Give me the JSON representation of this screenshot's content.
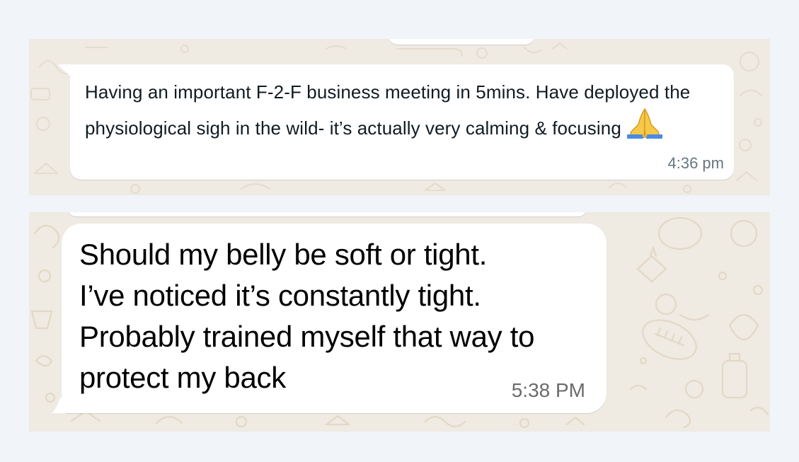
{
  "screenshot_1": {
    "message": {
      "text": "Having an important F-2-F business meeting in 5mins. Have deployed the physiological sigh in the wild- it’s actually very calming & focusing",
      "emoji": "folded-hands-emoji",
      "time": "4:36 pm"
    }
  },
  "screenshot_2": {
    "message": {
      "lines": [
        "Should my belly be soft or tight.",
        "I’ve noticed it’s constantly tight.",
        "Probably trained myself that way to",
        "protect my back"
      ],
      "time": "5:38 PM"
    }
  },
  "colors": {
    "page_background": "#f1f4f9",
    "chat_wallpaper": "#efeae2",
    "bubble_background": "#ffffff",
    "timestamp": "#667781"
  }
}
